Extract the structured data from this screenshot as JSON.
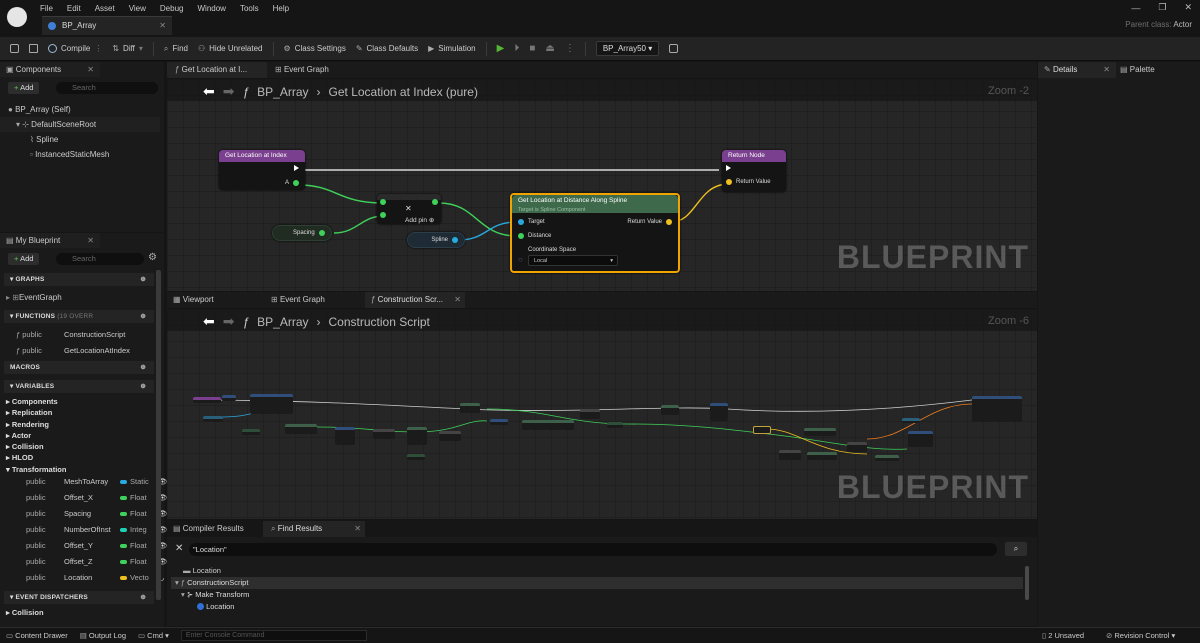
{
  "app": {
    "menu": [
      "File",
      "Edit",
      "Asset",
      "View",
      "Debug",
      "Window",
      "Tools",
      "Help"
    ],
    "document_tab": "BP_Array",
    "parent_class_label": "Parent class:",
    "parent_class_value": "Actor"
  },
  "toolbar": {
    "compile": "Compile",
    "diff": "Diff",
    "find": "Find",
    "hide_unrelated": "Hide Unrelated",
    "class_settings": "Class Settings",
    "class_defaults": "Class Defaults",
    "simulation": "Simulation",
    "debug_object": "BP_Array50"
  },
  "components_panel": {
    "tab": "Components",
    "add": "Add",
    "search_placeholder": "Search",
    "items": [
      "BP_Array (Self)",
      "DefaultSceneRoot",
      "Spline",
      "InstancedStaticMesh"
    ]
  },
  "my_blueprint": {
    "tab": "My Blueprint",
    "add": "Add",
    "search_placeholder": "Search",
    "graphs_header": "GRAPHS",
    "graphs": [
      "EventGraph"
    ],
    "functions_header": "FUNCTIONS",
    "functions_override": "(19 OVERR",
    "functions": [
      {
        "access": "public",
        "name": "ConstructionScript"
      },
      {
        "access": "public",
        "name": "GetLocationAtIndex"
      }
    ],
    "macros_header": "MACROS",
    "variables_header": "VARIABLES",
    "categories": [
      "Components",
      "Replication",
      "Rendering",
      "Actor",
      "Collision",
      "HLOD",
      "Transformation"
    ],
    "variables": [
      {
        "access": "public",
        "name": "MeshToArray",
        "type": "Static",
        "color": "#2aa9e0"
      },
      {
        "access": "public",
        "name": "Offset_X",
        "type": "Float",
        "color": "#3fd15a"
      },
      {
        "access": "public",
        "name": "Spacing",
        "type": "Float",
        "color": "#3fd15a"
      },
      {
        "access": "public",
        "name": "NumberOfInst",
        "type": "Integ",
        "color": "#1fd1b4"
      },
      {
        "access": "public",
        "name": "Offset_Y",
        "type": "Float",
        "color": "#3fd15a"
      },
      {
        "access": "public",
        "name": "Offset_Z",
        "type": "Float",
        "color": "#3fd15a"
      },
      {
        "access": "public",
        "name": "Location",
        "type": "Vecto",
        "color": "#f0c020"
      }
    ],
    "event_dispatchers_header": "EVENT DISPATCHERS",
    "dispatchers": [
      "Collision"
    ]
  },
  "top_graph": {
    "tabs": [
      "Get Location at I...",
      "Event Graph"
    ],
    "breadcrumb_root": "BP_Array",
    "breadcrumb_leaf": "Get Location at Index (pure)",
    "zoom": "Zoom -2",
    "watermark": "BLUEPRINT",
    "nodes": {
      "entry_title": "Get Location at Index",
      "entry_pin": "A",
      "spacing": "Spacing",
      "spline": "Spline",
      "add_pin": "Add pin",
      "spline_fn_title": "Get Location at Distance Along Spline",
      "spline_fn_sub": "Target is Spline Component",
      "target": "Target",
      "distance": "Distance",
      "coord_space": "Coordinate Space",
      "coord_value": "Local",
      "return_value": "Return Value",
      "return_title": "Return Node",
      "return_pin": "Return Value"
    }
  },
  "bottom_graph": {
    "tabs": [
      "Viewport",
      "Event Graph",
      "Construction Scr..."
    ],
    "breadcrumb_root": "BP_Array",
    "breadcrumb_leaf": "Construction Script",
    "zoom": "Zoom -6",
    "watermark": "BLUEPRINT"
  },
  "results": {
    "tabs": [
      "Compiler Results",
      "Find Results"
    ],
    "query": "\"Location\"",
    "items": [
      "Location",
      "ConstructionScript",
      "Make Transform",
      "Location"
    ]
  },
  "details": {
    "tabs": [
      "Details",
      "Palette"
    ]
  },
  "status": {
    "content_drawer": "Content Drawer",
    "output_log": "Output Log",
    "cmd": "Cmd",
    "console_placeholder": "Enter Console Command",
    "unsaved": "2 Unsaved",
    "revision": "Revision Control"
  }
}
